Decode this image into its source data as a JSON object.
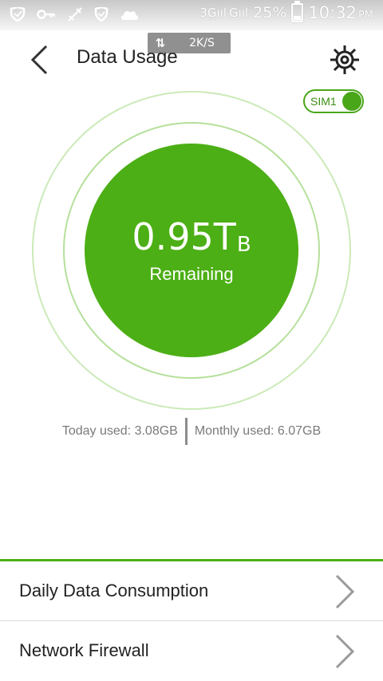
{
  "status_bar": {
    "signal_text": "3G̲̲ııl G̲ııl",
    "battery_percent": "25%",
    "time": "10:32",
    "ampm": "PM",
    "icons": [
      "shield-icon",
      "key-icon",
      "airplane-icon",
      "shield-icon",
      "cloud-icon"
    ]
  },
  "speed_indicator": {
    "arrows": "⇅",
    "value": "2K/S"
  },
  "header": {
    "title": "Data Usage"
  },
  "sim": {
    "label": "SIM1",
    "enabled": true
  },
  "usage_circle": {
    "remaining_value": "0.95T",
    "remaining_unit": "B",
    "remaining_label": "Remaining"
  },
  "usage_stats": {
    "today": "Today used: 3.08GB",
    "monthly": "Monthly used: 6.07GB"
  },
  "menu": {
    "items": [
      {
        "label": "Daily Data Consumption"
      },
      {
        "label": "Network Firewall"
      }
    ]
  },
  "colors": {
    "accent": "#4caf15",
    "ring_outer": "#cbeab8",
    "ring_inner": "#b5e09b"
  }
}
